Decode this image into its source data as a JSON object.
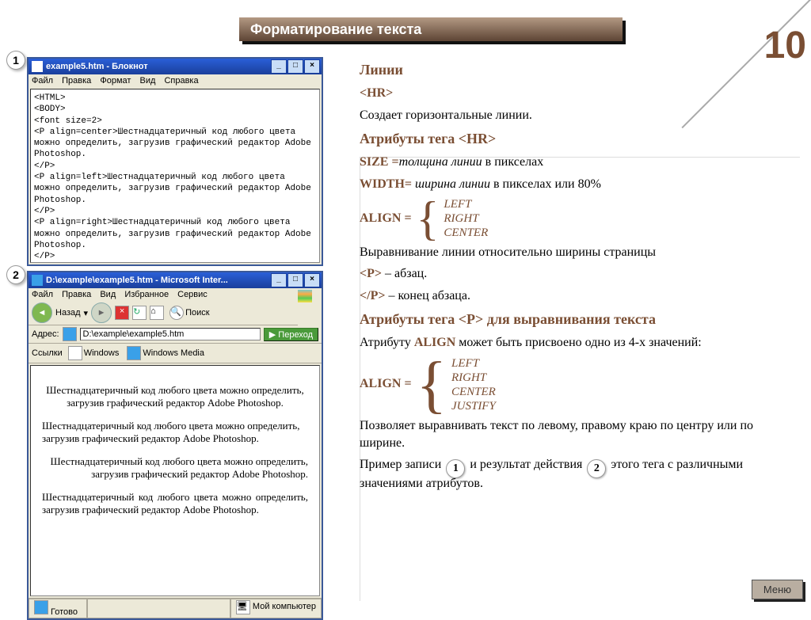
{
  "slide": {
    "number": "10",
    "title": "Форматирование текста",
    "menu": "Меню"
  },
  "badges": {
    "one": "1",
    "two": "2"
  },
  "notepad": {
    "title": "example5.htm - Блокнот",
    "menu": [
      "Файл",
      "Правка",
      "Формат",
      "Вид",
      "Справка"
    ],
    "code": "<HTML>\n<BODY>\n<font size=2>\n<P align=center>Шестнадцатеричный код любого цвета можно определить, загрузив графический редактор Adobe Photoshop.\n</P>\n<P align=left>Шестнадцатеричный код любого цвета можно определить, загрузив графический редактор Adobe Photoshop.\n</P>\n<P align=right>Шестнадцатеричный код любого цвета можно определить, загрузив графический редактор Adobe Photoshop.\n</P>\n<P align=justify>Шестнадцатеричный код любого цвета можно определить, загрузив графический редактор Adobe Photoshop.\n</P>\n</font>\n</BODY>\n</HTML>"
  },
  "ie": {
    "title": "D:\\example\\example5.htm - Microsoft Inter...",
    "menu": [
      "Файл",
      "Правка",
      "Вид",
      "Избранное",
      "Сервис"
    ],
    "back": "Назад",
    "search": "Поиск",
    "addr_label": "Адрес:",
    "addr": "D:\\example\\example5.htm",
    "go": "Переход",
    "links_label": "Ссылки",
    "link1": "Windows",
    "link2": "Windows Media",
    "body_center": "Шестнадцатеричный код любого цвета можно определить, загрузив графический редактор Adobe Photoshop.",
    "body_left": "Шестнадцатеричный код любого цвета можно определить, загрузив графический редактор Adobe Photoshop.",
    "body_right": "Шестнадцатеричный код любого цвета можно определить, загрузив графический редактор Adobe Photoshop.",
    "body_justify": "Шестнадцатеричный код любого цвета можно определить, загрузив графический редактор Adobe Photoshop.",
    "status_ready": "Готово",
    "status_comp": "Мой компьютер"
  },
  "c": {
    "h_lines": "Линии",
    "hr": "<HR>",
    "hr_desc": "Создает горизонтальные линии.",
    "h_attrs": "Атрибуты тега  <HR>",
    "size_lbl": "SIZE =",
    "size_txt": "толщина линии",
    "size_tail": " в пикселах",
    "width_lbl": "WIDTH=",
    "width_txt": " ширина линии",
    "width_tail": " в пикселах  или 80%",
    "align_lbl": "ALIGN = ",
    "opts1": [
      "LEFT",
      "RIGHT",
      "CENTER"
    ],
    "align_desc": "Выравнивание линии относительно ширины страницы",
    "p_open": "<P>",
    "p_open_t": " – абзац.",
    "p_close": "</P>",
    "p_close_t": " – конец абзаца.",
    "h_pattrs": "Атрибуты тега <P> для выравнивания текста",
    "p_align_desc1": "Атрибуту ",
    "p_align_bold": "ALIGN",
    "p_align_desc2": " может быть присвоено  одно из 4-х значений:",
    "opts2": [
      "LEFT",
      "RIGHT",
      "CENTER",
      "JUSTIFY"
    ],
    "tail1": "Позволяет выравнивать  текст по левому, правому краю по центру или по ширине.",
    "tail2a": "Пример записи ",
    "tail2b": " и результат действия ",
    "tail2c": " этого тега с различными значениями атрибутов."
  }
}
